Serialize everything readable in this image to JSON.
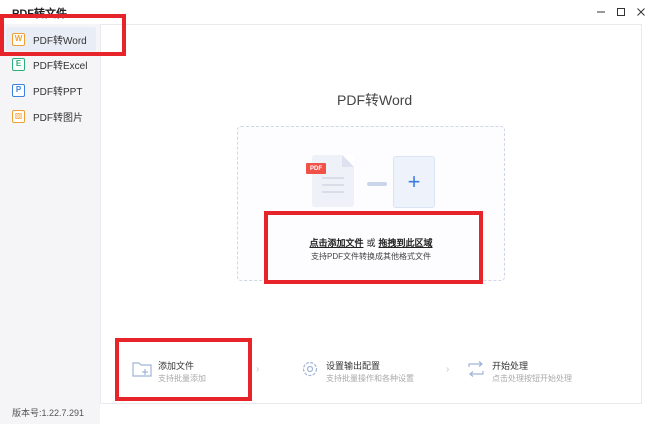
{
  "window": {
    "title": "PDF转文件"
  },
  "sidebar": {
    "items": [
      {
        "label": "PDF转Word",
        "glyph": "W"
      },
      {
        "label": "PDF转Excel",
        "glyph": "E"
      },
      {
        "label": "PDF转PPT",
        "glyph": "P"
      },
      {
        "label": "PDF转图片",
        "glyph": "▨"
      }
    ],
    "version": "版本号:1.22.7.291"
  },
  "main": {
    "title": "PDF转Word",
    "pdf_badge": "PDF",
    "plus": "+",
    "drop_click": "点击添加文件",
    "drop_or": "或",
    "drop_drag": "拖拽到此区域",
    "drop_sub": "支持PDF文件转换成其他格式文件"
  },
  "steps": [
    {
      "title": "添加文件",
      "sub": "支持批量添加"
    },
    {
      "title": "设置输出配置",
      "sub": "支持批量操作和各种设置"
    },
    {
      "title": "开始处理",
      "sub": "点击处理按钮开始处理"
    }
  ],
  "colors": {
    "accent": "#3d7be0",
    "highlight_box": "#e8242b",
    "pdf_badge": "#f0524a"
  }
}
